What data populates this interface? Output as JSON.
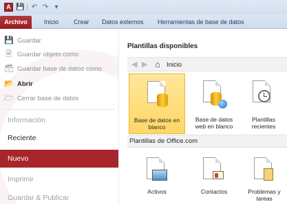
{
  "titlebar": {
    "app_icon_letter": "A",
    "icons": [
      "access-app-icon",
      "save-icon",
      "undo-icon",
      "redo-icon",
      "customize-qat-icon"
    ]
  },
  "ribbon": {
    "tabs": [
      {
        "label": "Archivo"
      },
      {
        "label": "Inicio"
      },
      {
        "label": "Crear"
      },
      {
        "label": "Datos externos"
      },
      {
        "label": "Herramientas de base de datos"
      }
    ]
  },
  "backstage": {
    "commands": [
      {
        "label": "Guardar",
        "enabled": false
      },
      {
        "label": "Guardar objeto como",
        "enabled": false
      },
      {
        "label": "Guardar base de datos como",
        "enabled": false
      },
      {
        "label": "Abrir",
        "enabled": true
      },
      {
        "label": "Cerrar base de datos",
        "enabled": false
      }
    ],
    "nav": [
      {
        "label": "Información",
        "state": "disabled"
      },
      {
        "label": "Reciente",
        "state": "normal"
      },
      {
        "label": "Nuevo",
        "state": "selected"
      },
      {
        "label": "Imprimir",
        "state": "disabled"
      },
      {
        "label": "Guardar & Publicar",
        "state": "disabled"
      }
    ]
  },
  "main": {
    "heading": "Plantillas disponibles",
    "breadcrumb": "Inicio",
    "templates": [
      {
        "label_line1": "Base de datos en",
        "label_line2": "blanco",
        "selected": true
      },
      {
        "label_line1": "Base de datos",
        "label_line2": "web en blanco",
        "selected": false
      },
      {
        "label_line1": "Plantillas",
        "label_line2": "recientes",
        "selected": false
      }
    ],
    "section_title": "Plantillas de Office.com",
    "office_templates": [
      {
        "label_line1": "Activos",
        "label_line2": ""
      },
      {
        "label_line1": "Contactos",
        "label_line2": ""
      },
      {
        "label_line1": "Problemas y",
        "label_line2": "tareas"
      }
    ]
  },
  "colors": {
    "file_tab": "#a8262b",
    "selected_nav": "#a8262b",
    "selected_tile": "#ffd766",
    "ribbon_bg": "#dbe6f4"
  }
}
